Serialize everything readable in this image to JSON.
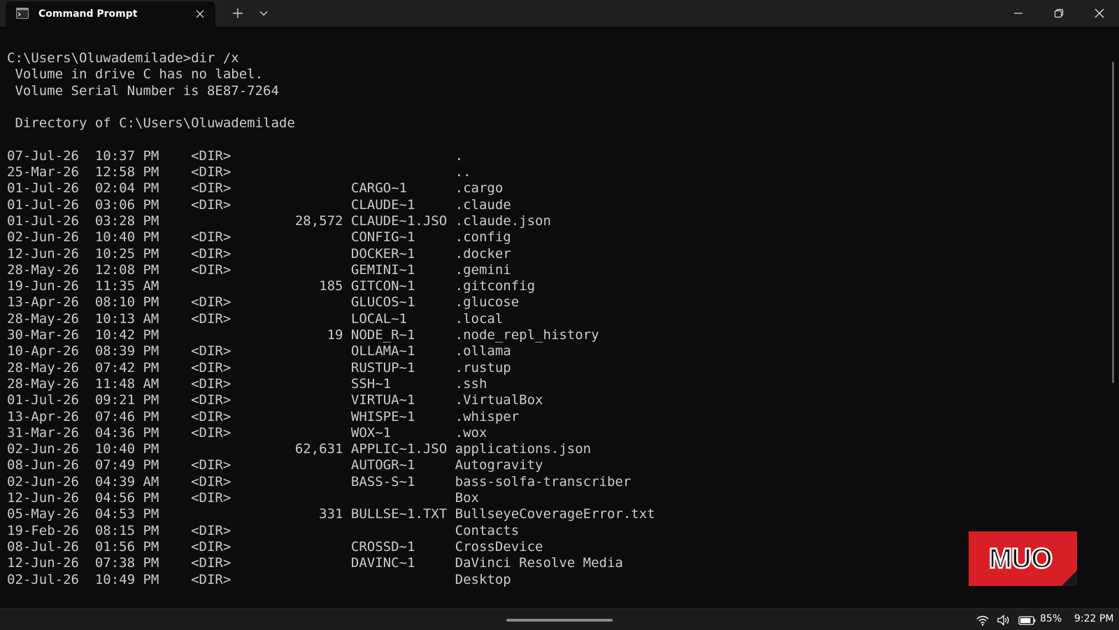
{
  "window": {
    "tab_title": "Command Prompt",
    "tab_icon": "terminal-icon"
  },
  "terminal": {
    "header_lines": [
      "C:\\Users\\Oluwademilade>dir /x",
      " Volume in drive C has no label.",
      " Volume Serial Number is 8E87-7264",
      "",
      " Directory of C:\\Users\\Oluwademilade",
      ""
    ],
    "listing": [
      {
        "date": "07-Jul-26",
        "time": "10:37 PM",
        "type": "<DIR>",
        "size": "",
        "short_name": "",
        "name": "."
      },
      {
        "date": "25-Mar-26",
        "time": "12:58 PM",
        "type": "<DIR>",
        "size": "",
        "short_name": "",
        "name": ".."
      },
      {
        "date": "01-Jul-26",
        "time": "02:04 PM",
        "type": "<DIR>",
        "size": "",
        "short_name": "CARGO~1",
        "name": ".cargo"
      },
      {
        "date": "01-Jul-26",
        "time": "03:06 PM",
        "type": "<DIR>",
        "size": "",
        "short_name": "CLAUDE~1",
        "name": ".claude"
      },
      {
        "date": "01-Jul-26",
        "time": "03:28 PM",
        "type": "",
        "size": "28,572",
        "short_name": "CLAUDE~1.JSO",
        "name": ".claude.json"
      },
      {
        "date": "02-Jun-26",
        "time": "10:40 PM",
        "type": "<DIR>",
        "size": "",
        "short_name": "CONFIG~1",
        "name": ".config"
      },
      {
        "date": "12-Jun-26",
        "time": "10:25 PM",
        "type": "<DIR>",
        "size": "",
        "short_name": "DOCKER~1",
        "name": ".docker"
      },
      {
        "date": "28-May-26",
        "time": "12:08 PM",
        "type": "<DIR>",
        "size": "",
        "short_name": "GEMINI~1",
        "name": ".gemini"
      },
      {
        "date": "19-Jun-26",
        "time": "11:35 AM",
        "type": "",
        "size": "185",
        "short_name": "GITCON~1",
        "name": ".gitconfig"
      },
      {
        "date": "13-Apr-26",
        "time": "08:10 PM",
        "type": "<DIR>",
        "size": "",
        "short_name": "GLUCOS~1",
        "name": ".glucose"
      },
      {
        "date": "28-May-26",
        "time": "10:13 AM",
        "type": "<DIR>",
        "size": "",
        "short_name": "LOCAL~1",
        "name": ".local"
      },
      {
        "date": "30-Mar-26",
        "time": "10:42 PM",
        "type": "",
        "size": "19",
        "short_name": "NODE_R~1",
        "name": ".node_repl_history"
      },
      {
        "date": "10-Apr-26",
        "time": "08:39 PM",
        "type": "<DIR>",
        "size": "",
        "short_name": "OLLAMA~1",
        "name": ".ollama"
      },
      {
        "date": "28-May-26",
        "time": "07:42 PM",
        "type": "<DIR>",
        "size": "",
        "short_name": "RUSTUP~1",
        "name": ".rustup"
      },
      {
        "date": "28-May-26",
        "time": "11:48 AM",
        "type": "<DIR>",
        "size": "",
        "short_name": "SSH~1",
        "name": ".ssh"
      },
      {
        "date": "01-Jul-26",
        "time": "09:21 PM",
        "type": "<DIR>",
        "size": "",
        "short_name": "VIRTUA~1",
        "name": ".VirtualBox"
      },
      {
        "date": "13-Apr-26",
        "time": "07:46 PM",
        "type": "<DIR>",
        "size": "",
        "short_name": "WHISPE~1",
        "name": ".whisper"
      },
      {
        "date": "31-Mar-26",
        "time": "04:36 PM",
        "type": "<DIR>",
        "size": "",
        "short_name": "WOX~1",
        "name": ".wox"
      },
      {
        "date": "02-Jun-26",
        "time": "10:40 PM",
        "type": "",
        "size": "62,631",
        "short_name": "APPLIC~1.JSO",
        "name": "applications.json"
      },
      {
        "date": "08-Jun-26",
        "time": "07:49 PM",
        "type": "<DIR>",
        "size": "",
        "short_name": "AUTOGR~1",
        "name": "Autogravity"
      },
      {
        "date": "02-Jun-26",
        "time": "04:39 AM",
        "type": "<DIR>",
        "size": "",
        "short_name": "BASS-S~1",
        "name": "bass-solfa-transcriber"
      },
      {
        "date": "12-Jun-26",
        "time": "04:56 PM",
        "type": "<DIR>",
        "size": "",
        "short_name": "",
        "name": "Box"
      },
      {
        "date": "05-May-26",
        "time": "04:53 PM",
        "type": "",
        "size": "331",
        "short_name": "BULLSE~1.TXT",
        "name": "BullseyeCoverageError.txt"
      },
      {
        "date": "19-Feb-26",
        "time": "08:15 PM",
        "type": "<DIR>",
        "size": "",
        "short_name": "",
        "name": "Contacts"
      },
      {
        "date": "08-Jul-26",
        "time": "01:56 PM",
        "type": "<DIR>",
        "size": "",
        "short_name": "CROSSD~1",
        "name": "CrossDevice"
      },
      {
        "date": "12-Jun-26",
        "time": "07:38 PM",
        "type": "<DIR>",
        "size": "",
        "short_name": "DAVINC~1",
        "name": "DaVinci Resolve Media"
      },
      {
        "date": "02-Jul-26",
        "time": "10:49 PM",
        "type": "<DIR>",
        "size": "",
        "short_name": "",
        "name": "Desktop"
      }
    ]
  },
  "watermark": {
    "text": "MUO",
    "color": "#d91f26"
  },
  "taskbar": {
    "battery": "85%",
    "clock": "9:22 PM",
    "icons": [
      "wifi-icon",
      "volume-icon",
      "battery-icon"
    ]
  },
  "colors": {
    "terminal_bg": "#0c0c0c",
    "terminal_fg": "#cccccc",
    "titlebar_bg": "#1f1f1f"
  }
}
